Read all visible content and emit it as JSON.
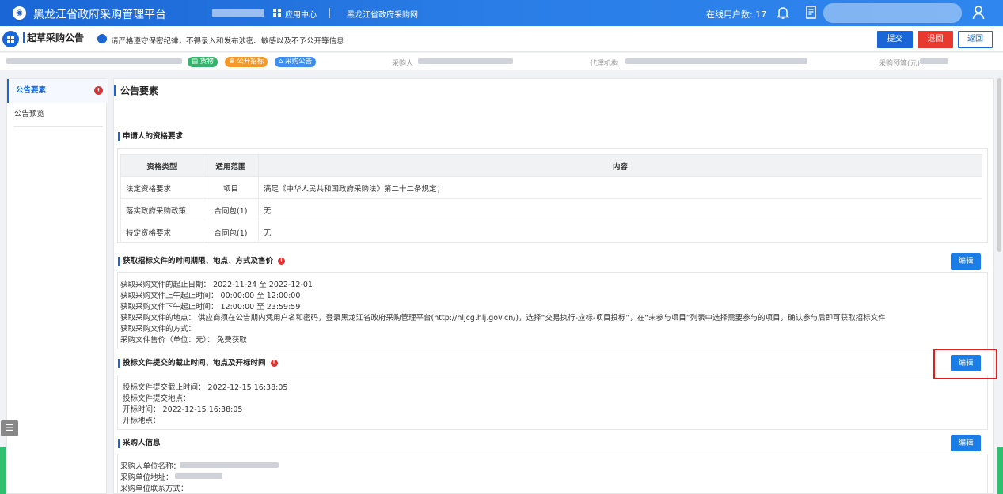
{
  "topbar": {
    "title": "黑龙江省政府采购管理平台",
    "app_center": "应用中心",
    "website": "黑龙江省政府采购网",
    "online_users_label": "在线用户数: ",
    "online_users_count": "17"
  },
  "actionbar": {
    "page_title": "起草采购公告",
    "notice": "请严格遵守保密纪律，不得录入和发布涉密、敏感以及不予公开等信息",
    "submit": "提交",
    "reject": "退回",
    "back": "返回"
  },
  "infobar": {
    "tags": [
      "货物",
      "公开招标",
      "采购公告"
    ],
    "purchaser_label": "采购人",
    "agency_label": "代理机构",
    "budget_label": "采购预算(元):"
  },
  "leftnav": {
    "items": [
      "公告要素",
      "公告预览"
    ],
    "error_mark": "!"
  },
  "main": {
    "title": "公告要素",
    "qualification": {
      "title": "申请人的资格要求",
      "headers": [
        "资格类型",
        "适用范围",
        "内容"
      ],
      "rows": [
        [
          "法定资格要求",
          "项目",
          "满足《中华人民共和国政府采购法》第二十二条规定；"
        ],
        [
          "落实政府采购政策",
          "合同包(1)",
          "无"
        ],
        [
          "特定资格要求",
          "合同包(1)",
          "无"
        ]
      ]
    },
    "obtain": {
      "title": "获取招标文件的时间期限、地点、方式及售价",
      "edit": "编辑",
      "lines": [
        "获取采购文件的起止日期：  2022-11-24 至 2022-12-01",
        "获取采购文件上午起止时间：  00:00:00 至 12:00:00",
        "获取采购文件下午起止时间：  12:00:00 至 23:59:59",
        "获取采购文件的地点：  供应商须在公告期内凭用户名和密码，登录黑龙江省政府采购管理平台(http://hljcg.hlj.gov.cn/)，选择“交易执行-应标-项目投标”，在“未参与项目”列表中选择需要参与的项目，确认参与后即可获取招标文件",
        "获取采购文件的方式：",
        "采购文件售价（单位：元）：  免费获取"
      ]
    },
    "submission": {
      "title": "投标文件提交的截止时间、地点及开标时间",
      "edit": "编辑",
      "lines": [
        "投标文件提交截止时间：  2022-12-15 16:38:05",
        "投标文件提交地点：",
        "开标时间：  2022-12-15 16:38:05",
        "开标地点："
      ]
    },
    "purchaser": {
      "title": "采购人信息",
      "edit": "编辑",
      "lines": [
        "采购人单位名称：",
        "采购单位地址：",
        "采购单位联系方式："
      ]
    }
  },
  "colors": {
    "primary": "#1a66d6",
    "danger": "#e8392f",
    "tag_green": "#33b36b",
    "tag_orange": "#f39a2b",
    "tag_blue": "#3e8ef0"
  }
}
